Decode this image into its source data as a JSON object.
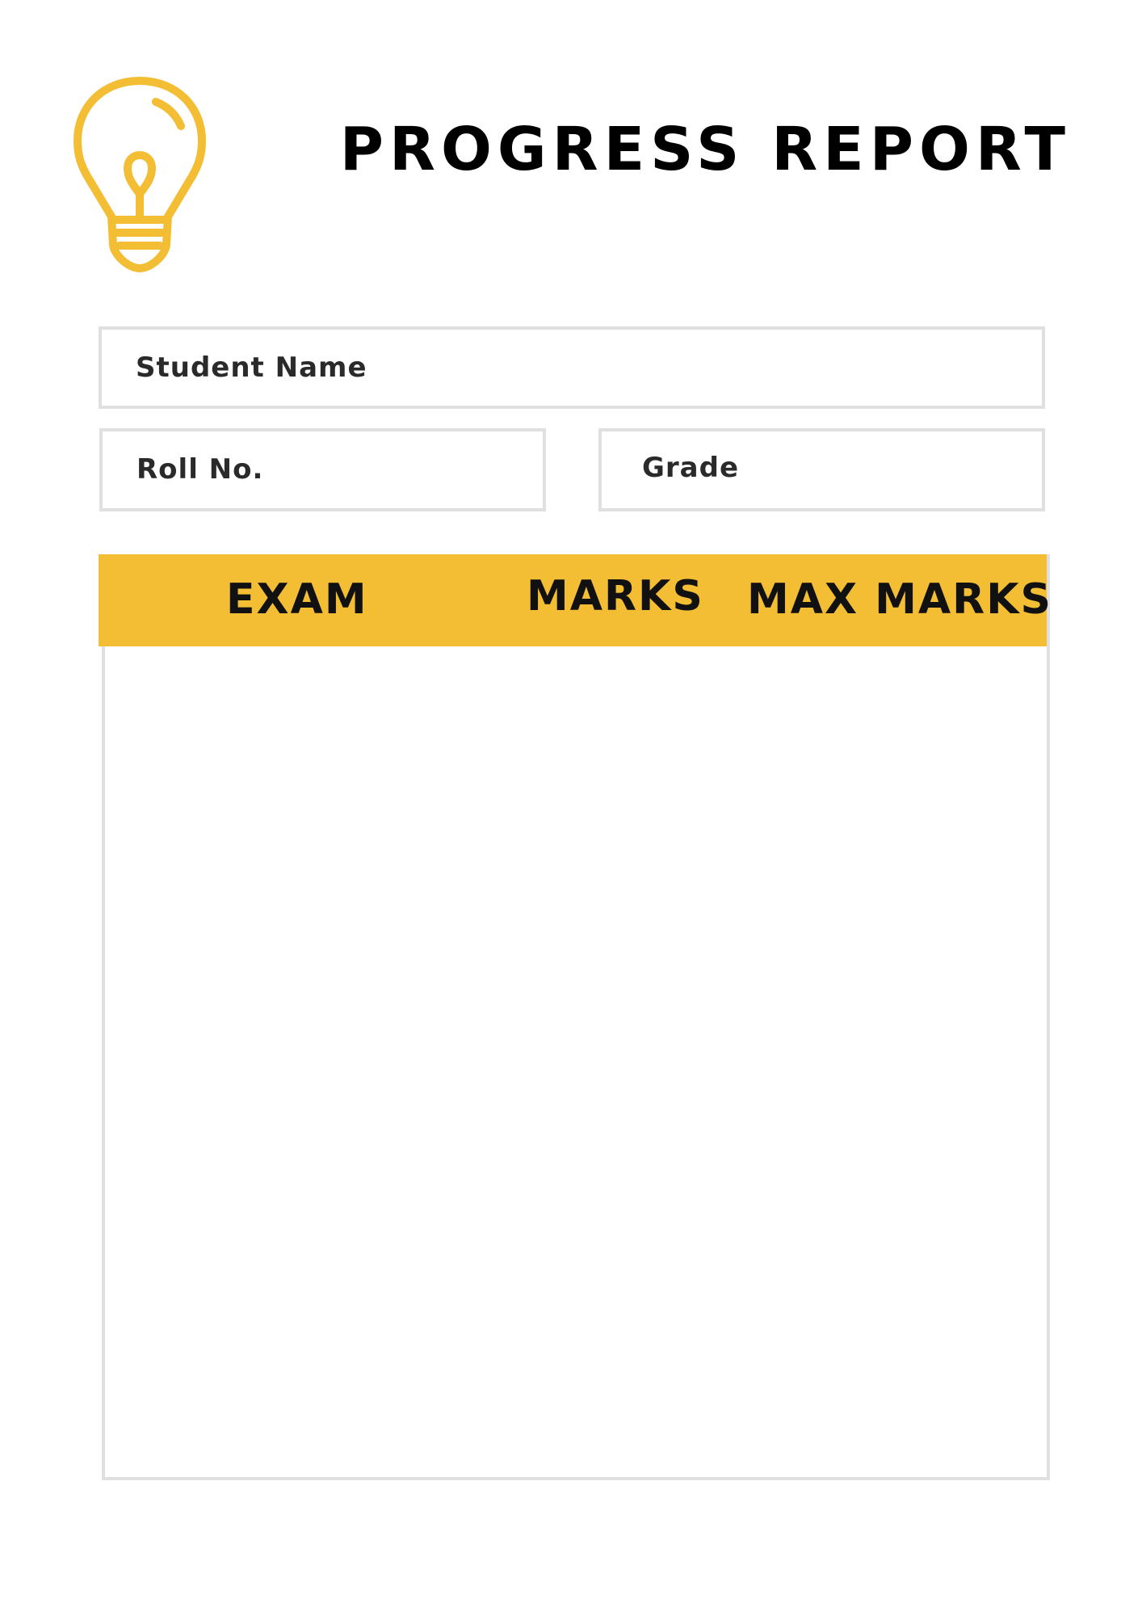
{
  "header": {
    "logo_icon": "lightbulb-icon",
    "accent_color": "#f3bd34",
    "title": "PROGRESS REPORT"
  },
  "fields": {
    "student_name_label": "Student Name",
    "roll_no_label": "Roll No.",
    "grade_label": "Grade"
  },
  "table": {
    "header_color": "#f3bd34",
    "columns": [
      "EXAM",
      "MARKS",
      "MAX MARKS"
    ],
    "rows": []
  }
}
